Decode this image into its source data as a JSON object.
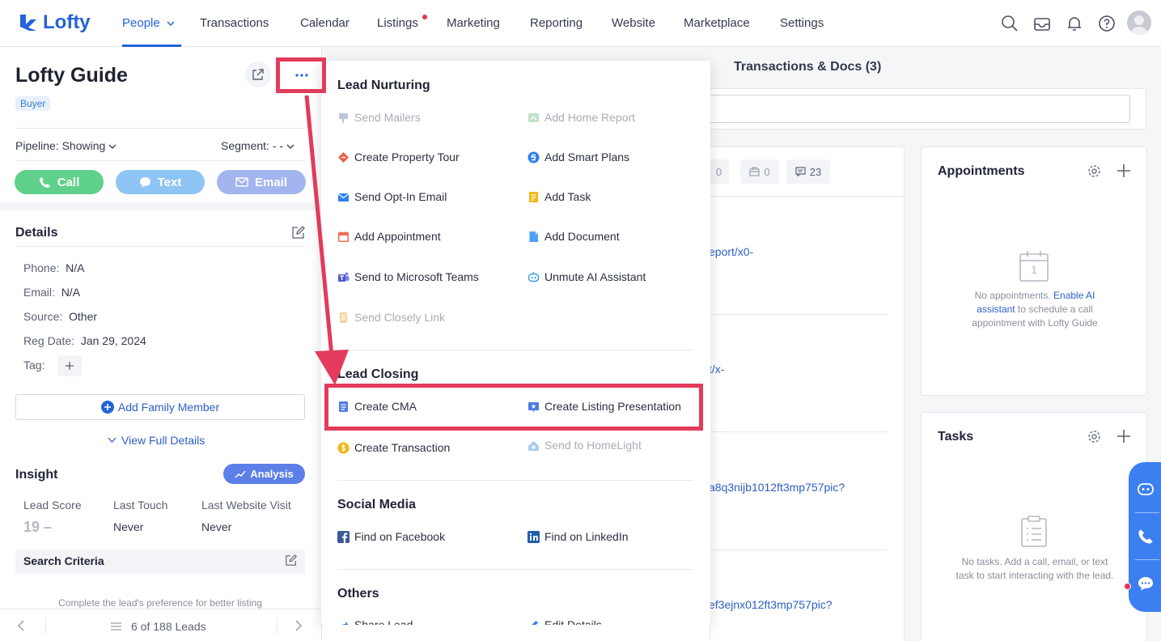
{
  "brand": {
    "name": "Lofty"
  },
  "nav": {
    "items": [
      "People",
      "Transactions",
      "Calendar",
      "Listings",
      "Marketing",
      "Reporting",
      "Website",
      "Marketplace",
      "Settings"
    ]
  },
  "lead": {
    "name": "Lofty Guide",
    "type_badge": "Buyer",
    "pipeline": "Pipeline: Showing",
    "segment": "Segment: - -",
    "call": "Call",
    "text": "Text",
    "email": "Email"
  },
  "details": {
    "heading": "Details",
    "phone_label": "Phone:",
    "phone_value": "N/A",
    "email_label": "Email:",
    "email_value": "N/A",
    "source_label": "Source:",
    "source_value": "Other",
    "reg_label": "Reg Date:",
    "reg_value": "Jan 29, 2024",
    "tag_label": "Tag:",
    "add_family": "Add Family Member",
    "view_full": "View Full Details"
  },
  "insight": {
    "heading": "Insight",
    "analysis": "Analysis",
    "lead_score_label": "Lead Score",
    "lead_score_value": "19",
    "last_touch_label": "Last Touch",
    "last_touch_value": "Never",
    "last_visit_label": "Last Website Visit",
    "last_visit_value": "Never",
    "search_criteria": "Search Criteria",
    "complete_hint": "Complete the lead's preference for better listing"
  },
  "pager": {
    "text": "6 of 188 Leads"
  },
  "main": {
    "tab_transactions": "Transactions & Docs (3)",
    "count_a": "0",
    "count_b": "0",
    "count_c": "23",
    "link1": "eport/x0-",
    "link2": "t/x-",
    "link3": "a8q3nijb1012ft3mp757pic?",
    "link4": "ef3ejnx012ft3mp757pic?"
  },
  "appointments": {
    "title": "Appointments",
    "cal_day": "1",
    "empty_a": "No appointments.",
    "empty_link": "Enable AI assistant",
    "empty_b": "to schedule a call appointment with Lofty Guide"
  },
  "tasks": {
    "title": "Tasks",
    "empty": "No tasks. Add a call, email, or text task to start interacting with the lead."
  },
  "menu": {
    "lead_nurturing": {
      "heading": "Lead Nurturing",
      "send_mailers": "Send Mailers",
      "add_home_report": "Add Home Report",
      "create_property_tour": "Create Property Tour",
      "add_smart_plans": "Add Smart Plans",
      "send_opt_in_email": "Send Opt-In Email",
      "add_task": "Add Task",
      "add_appointment": "Add Appointment",
      "add_document": "Add Document",
      "send_ms_teams": "Send to Microsoft Teams",
      "unmute_ai": "Unmute AI Assistant",
      "send_closely": "Send Closely Link"
    },
    "lead_closing": {
      "heading": "Lead Closing",
      "create_cma": "Create CMA",
      "create_listing_presentation": "Create Listing Presentation",
      "create_transaction": "Create Transaction",
      "send_homelight": "Send to HomeLight"
    },
    "social_media": {
      "heading": "Social Media",
      "facebook": "Find on Facebook",
      "linkedin": "Find on LinkedIn"
    },
    "others": {
      "heading": "Others",
      "share_lead": "Share Lead",
      "edit_details": "Edit Details"
    }
  },
  "colors": {
    "accent": "#2463d8",
    "call": "#5fd18a",
    "text": "#8ec5f5",
    "email": "#a3b5ee",
    "annotation": "#e23b5b"
  }
}
